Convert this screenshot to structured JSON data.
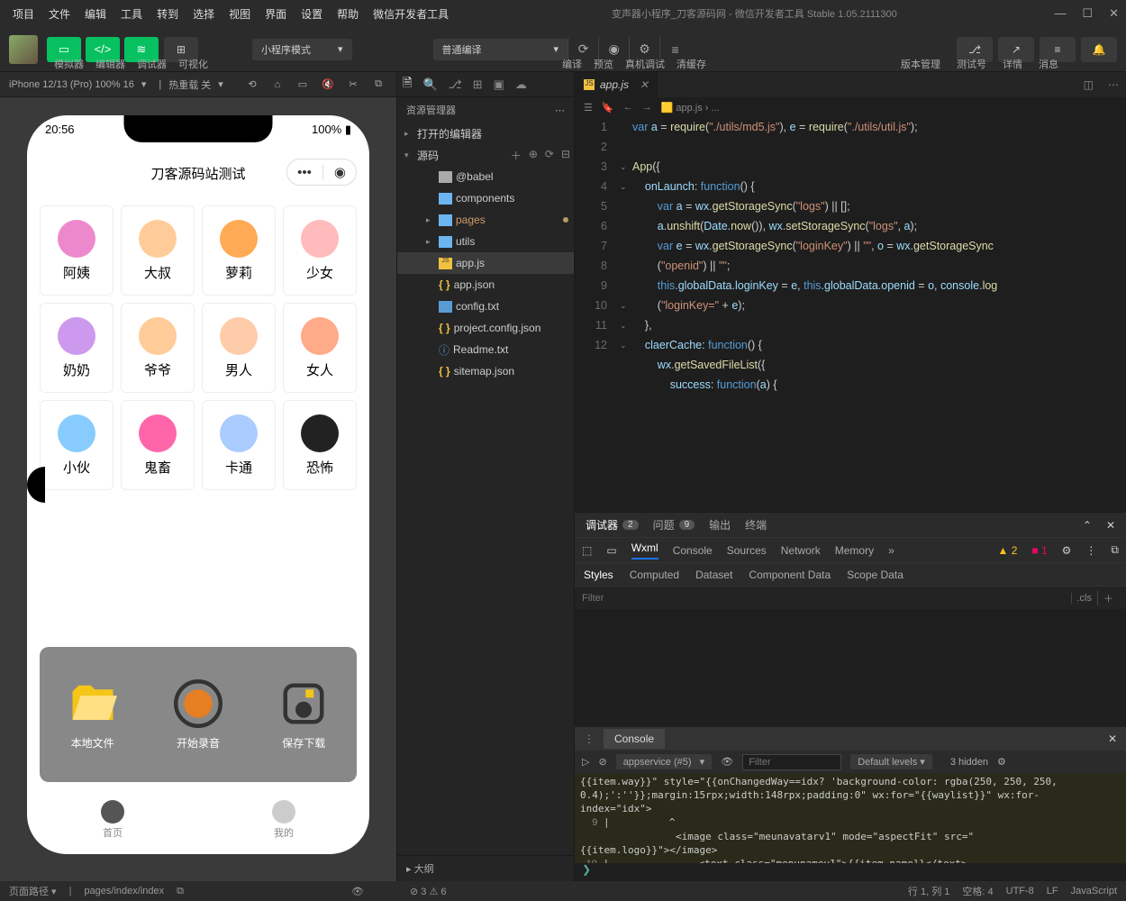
{
  "menubar": [
    "项目",
    "文件",
    "编辑",
    "工具",
    "转到",
    "选择",
    "视图",
    "界面",
    "设置",
    "帮助",
    "微信开发者工具"
  ],
  "title": "变声器小程序_刀客源码网 - 微信开发者工具 Stable 1.05.2111300",
  "toolbar": {
    "labels": [
      "模拟器",
      "编辑器",
      "调试器",
      "可视化"
    ],
    "mode": "小程序模式",
    "compile": "普通编译",
    "actions": [
      "编译",
      "预览",
      "真机调试",
      "清缓存"
    ],
    "right": [
      "版本管理",
      "测试号",
      "详情",
      "消息"
    ]
  },
  "sim": {
    "device": "iPhone 12/13 (Pro) 100% 16",
    "hot": "热重载 关"
  },
  "phone": {
    "time": "20:56",
    "battery": "100%",
    "title": "刀客源码站测试",
    "cells": [
      "阿姨",
      "大叔",
      "萝莉",
      "少女",
      "奶奶",
      "爷爷",
      "男人",
      "女人",
      "小伙",
      "鬼畜",
      "卡通",
      "恐怖"
    ],
    "bottom": [
      "本地文件",
      "开始录音",
      "保存下载"
    ],
    "tabs": [
      "首页",
      "我的"
    ]
  },
  "explorer": {
    "title": "资源管理器",
    "open": "打开的编辑器",
    "root": "源码",
    "tree": [
      {
        "name": "@babel",
        "type": "folder",
        "indent": 2
      },
      {
        "name": "components",
        "type": "folderb",
        "indent": 2
      },
      {
        "name": "pages",
        "type": "folderb",
        "indent": 2,
        "arrow": "▸",
        "mod": true,
        "color": "#d19a66"
      },
      {
        "name": "utils",
        "type": "folderb",
        "indent": 2,
        "arrow": "▸"
      },
      {
        "name": "app.js",
        "type": "js",
        "indent": 2,
        "sel": true
      },
      {
        "name": "app.json",
        "type": "json",
        "indent": 2,
        "brace": true
      },
      {
        "name": "config.txt",
        "type": "txt",
        "indent": 2
      },
      {
        "name": "project.config.json",
        "type": "json",
        "indent": 2,
        "brace": true
      },
      {
        "name": "Readme.txt",
        "type": "info",
        "indent": 2
      },
      {
        "name": "sitemap.json",
        "type": "json",
        "indent": 2,
        "brace": true
      }
    ],
    "outline": "大纲"
  },
  "editor": {
    "tab": "app.js",
    "crumb": "app.js › ..."
  },
  "debug": {
    "tabs": [
      {
        "l": "调试器",
        "b": "2"
      },
      {
        "l": "问题",
        "b": "9"
      },
      {
        "l": "输出"
      },
      {
        "l": "终端"
      }
    ]
  },
  "devtools": {
    "tabs": [
      "Wxml",
      "Console",
      "Sources",
      "Network",
      "Memory"
    ],
    "warn": "▲ 2",
    "err": "■ 1"
  },
  "styles": {
    "tabs": [
      "Styles",
      "Computed",
      "Dataset",
      "Component Data",
      "Scope Data"
    ],
    "filter": "Filter",
    "cls": ".cls"
  },
  "console": {
    "title": "Console",
    "ctx": "appservice (#5)",
    "levels": "Default levels",
    "hidden": "3 hidden",
    "filter": "Filter"
  },
  "status": {
    "path_lbl": "页面路径",
    "path": "pages/index/index",
    "err": "⊘ 3 ⚠ 6",
    "pos": "行 1, 列 1",
    "sp": "空格: 4",
    "enc": "UTF-8",
    "eol": "LF",
    "lang": "JavaScript"
  }
}
